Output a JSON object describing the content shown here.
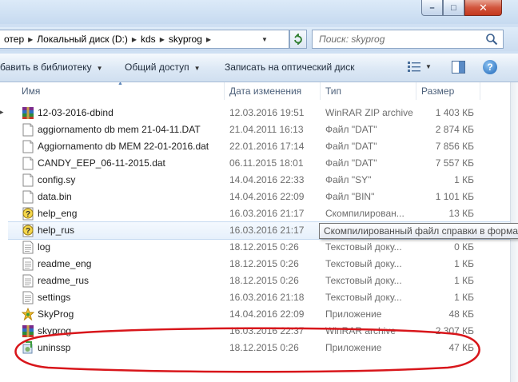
{
  "window": {
    "minimize_label": "–",
    "maximize_label": "□",
    "close_label": "✕"
  },
  "address": {
    "crumbs": [
      "отер",
      "Локальный диск (D:)",
      "kds",
      "skyprog"
    ],
    "search_placeholder": "Поиск: skyprog"
  },
  "toolbar": {
    "library_label": "бавить в библиотеку",
    "share_label": "Общий доступ",
    "burn_label": "Записать на оптический диск",
    "help_label": "?"
  },
  "columns": {
    "name": "Имя",
    "date": "Дата изменения",
    "type": "Тип",
    "size": "Размер"
  },
  "files": [
    {
      "name": "12-03-2016-dbind",
      "date": "12.03.2016 19:51",
      "type": "WinRAR ZIP archive",
      "size": "1 403 КБ",
      "icon": "winrar-icon"
    },
    {
      "name": "aggiornamento db mem 21-04-11.DAT",
      "date": "21.04.2011 16:13",
      "type": "Файл \"DAT\"",
      "size": "2 874 КБ",
      "icon": "file-icon"
    },
    {
      "name": "Aggiornamento db MEM 22-01-2016.dat",
      "date": "22.01.2016 17:14",
      "type": "Файл \"DAT\"",
      "size": "7 856 КБ",
      "icon": "file-icon"
    },
    {
      "name": "CANDY_EEP_06-11-2015.dat",
      "date": "06.11.2015 18:01",
      "type": "Файл \"DAT\"",
      "size": "7 557 КБ",
      "icon": "file-icon"
    },
    {
      "name": "config.sy",
      "date": "14.04.2016 22:33",
      "type": "Файл \"SY\"",
      "size": "1 КБ",
      "icon": "file-icon"
    },
    {
      "name": "data.bin",
      "date": "14.04.2016 22:09",
      "type": "Файл \"BIN\"",
      "size": "1 101 КБ",
      "icon": "file-icon"
    },
    {
      "name": "help_eng",
      "date": "16.03.2016 21:17",
      "type": "Скомпилирован...",
      "size": "13 КБ",
      "icon": "chm-help-icon"
    },
    {
      "name": "help_rus",
      "date": "16.03.2016 21:17",
      "type": "",
      "size": "",
      "icon": "chm-help-icon",
      "hover": true
    },
    {
      "name": "log",
      "date": "18.12.2015 0:26",
      "type": "Текстовый доку...",
      "size": "0 КБ",
      "icon": "text-doc-icon"
    },
    {
      "name": "readme_eng",
      "date": "18.12.2015 0:26",
      "type": "Текстовый доку...",
      "size": "1 КБ",
      "icon": "text-doc-icon"
    },
    {
      "name": "readme_rus",
      "date": "18.12.2015 0:26",
      "type": "Текстовый доку...",
      "size": "1 КБ",
      "icon": "text-doc-icon"
    },
    {
      "name": "settings",
      "date": "16.03.2016 21:18",
      "type": "Текстовый доку...",
      "size": "1 КБ",
      "icon": "text-doc-icon"
    },
    {
      "name": "SkyProg",
      "date": "14.04.2016 22:09",
      "type": "Приложение",
      "size": "48 КБ",
      "icon": "skyprog-app-icon"
    },
    {
      "name": "skyprog",
      "date": "16.03.2016 22:37",
      "type": "WinRAR archive",
      "size": "2 307 КБ",
      "icon": "winrar-icon"
    },
    {
      "name": "uninssp",
      "date": "18.12.2015 0:26",
      "type": "Приложение",
      "size": "47 КБ",
      "icon": "installer-app-icon"
    }
  ],
  "tooltip": {
    "text": "Скомпилированный файл справки в форма"
  },
  "annotation": {
    "color": "#d8161b",
    "shape": "ellipse",
    "target": "uninssp"
  }
}
